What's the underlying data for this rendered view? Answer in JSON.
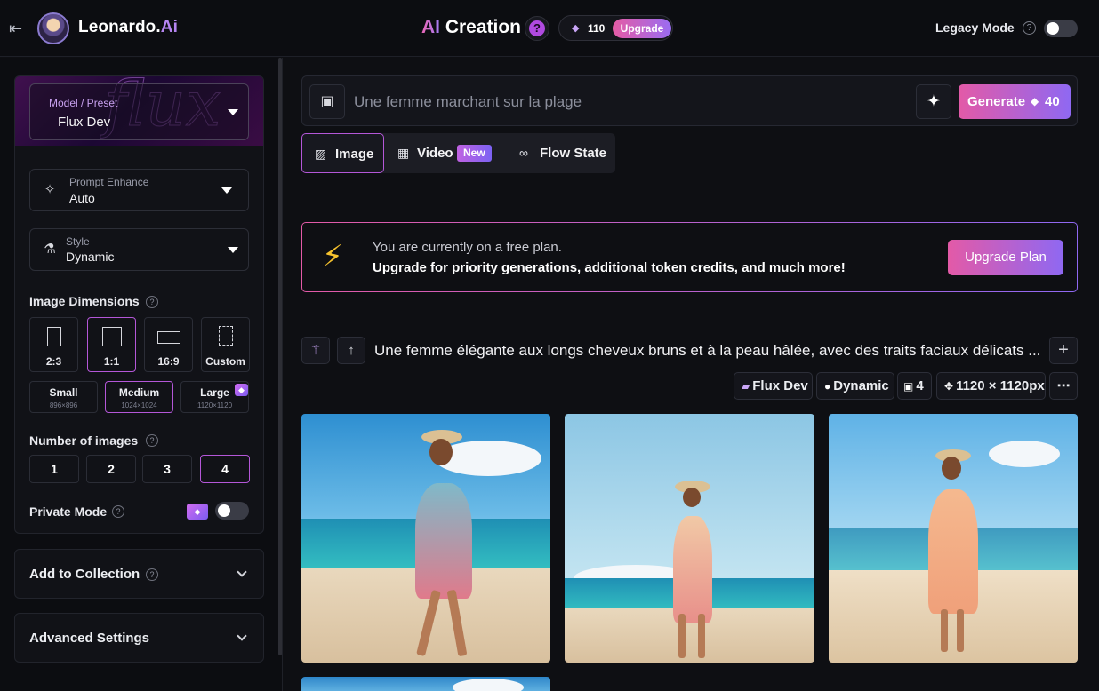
{
  "header": {
    "brand_name": "Leonardo.",
    "brand_suffix": "Ai",
    "title_prefix": "AI",
    "title_rest": " Creation",
    "help_symbol": "?",
    "token_count": "110",
    "upgrade_label": "Upgrade",
    "legacy_label": "Legacy Mode",
    "legacy_enabled": false
  },
  "sidebar": {
    "model": {
      "label": "Model / Preset",
      "value": "Flux Dev"
    },
    "prompt_enhance": {
      "label": "Prompt Enhance",
      "value": "Auto"
    },
    "style": {
      "label": "Style",
      "value": "Dynamic"
    },
    "dimensions": {
      "title": "Image Dimensions",
      "ratios": [
        "2:3",
        "1:1",
        "16:9",
        "Custom"
      ],
      "selected_ratio": "1:1",
      "sizes": [
        {
          "name": "Small",
          "px": "896×896"
        },
        {
          "name": "Medium",
          "px": "1024×1024"
        },
        {
          "name": "Large",
          "px": "1120×1120"
        }
      ],
      "selected_size": "Medium"
    },
    "number_of_images": {
      "title": "Number of images",
      "options": [
        "1",
        "2",
        "3",
        "4"
      ],
      "selected": "4"
    },
    "private_mode": {
      "label": "Private Mode",
      "enabled": false
    },
    "add_to_collection": "Add to Collection",
    "advanced_settings": "Advanced Settings"
  },
  "main": {
    "prompt_placeholder": "Une femme marchant sur la plage",
    "generate_label": "Generate",
    "generate_cost": "40",
    "tabs": [
      {
        "label": "Image",
        "active": true
      },
      {
        "label": "Video",
        "badge": "New"
      },
      {
        "label": "Flow State"
      }
    ],
    "banner": {
      "line1": "You are currently on a free plan.",
      "line2": "Upgrade for priority generations, additional token credits, and much more!",
      "button": "Upgrade Plan"
    },
    "generation": {
      "prompt": "Une femme élégante aux longs cheveux bruns et à la peau hâlée, avec des traits faciaux délicats ...",
      "tags": [
        "Flux Dev",
        "Dynamic",
        "4",
        "1120 × 1120px"
      ]
    }
  },
  "colors": {
    "accent_pink": "#e35aa7",
    "accent_purple": "#8f68f2",
    "selected_border": "#b457d8",
    "background": "#0e0f13"
  }
}
